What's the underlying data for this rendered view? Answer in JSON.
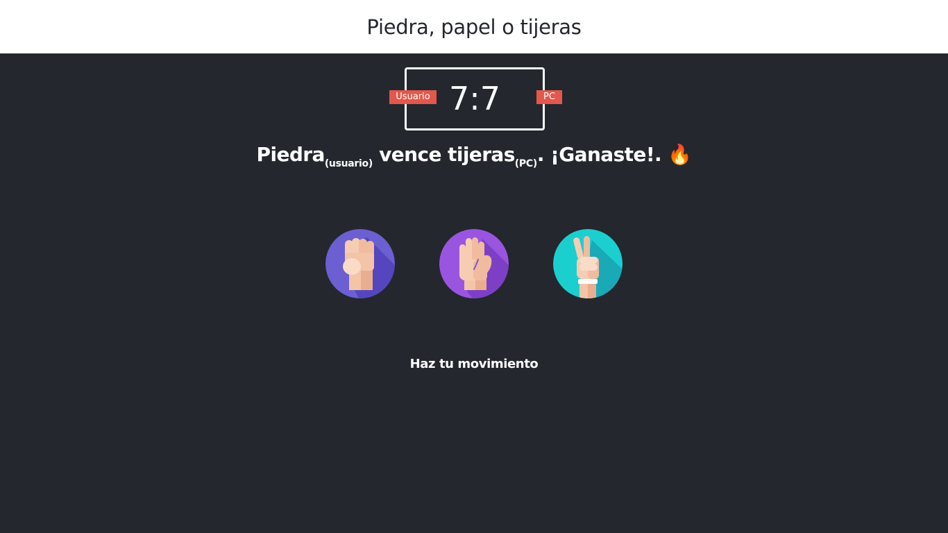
{
  "header": {
    "title": "Piedra, papel o tijeras"
  },
  "scoreboard": {
    "user_label": "Usuario",
    "pc_label": "PC",
    "score": "7:7"
  },
  "result": {
    "user_choice": "Piedra",
    "user_tag": "(usuario)",
    "verb": "vence",
    "pc_choice": "tijeras",
    "pc_tag": "(PC)",
    "outcome": ". ¡Ganaste!.",
    "emoji": "🔥"
  },
  "choices": [
    {
      "name": "rock",
      "icon": "fist-icon",
      "color": "#6b5fd2"
    },
    {
      "name": "paper",
      "icon": "open-hand-icon",
      "color": "#9a55e0"
    },
    {
      "name": "scissors",
      "icon": "victory-hand-icon",
      "color": "#1ccfcf"
    }
  ],
  "prompt": "Haz tu movimiento",
  "colors": {
    "background": "#24272e",
    "header_bg": "#ffffff",
    "badge": "#e2584d",
    "text": "#ffffff"
  }
}
